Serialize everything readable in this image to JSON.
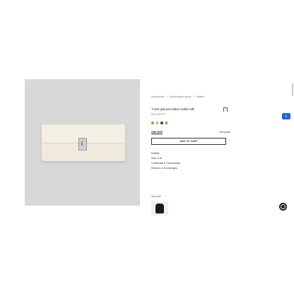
{
  "breadcrumb": [
    "Accessories",
    "/",
    "Small leather goods",
    "/",
    "Wallets"
  ],
  "product": {
    "title": "T-lock grained leather wallet milk",
    "price": "¥91,000 JPY"
  },
  "swatches": [
    {
      "name": "tan",
      "color": "#c98a3c"
    },
    {
      "name": "milk",
      "color": "#ece6d4"
    },
    {
      "name": "brown",
      "color": "#6b3b1e"
    },
    {
      "name": "caramel",
      "color": "#b8733a"
    }
  ],
  "size": {
    "label": "ONE SIZE",
    "guide": "Size guide"
  },
  "add_to_cart": "ADD TO CART",
  "links": [
    "Details",
    "Size & fit",
    "Certificate & Traceability",
    "Returns & Exchanges"
  ],
  "styled_with": {
    "label": "Style with"
  },
  "side_badge": "F",
  "colors": {
    "accent_badge": "#1f63e6",
    "image_bg": "#d9d8d9"
  },
  "icons": [
    "bookmark-icon",
    "chat-icon"
  ]
}
